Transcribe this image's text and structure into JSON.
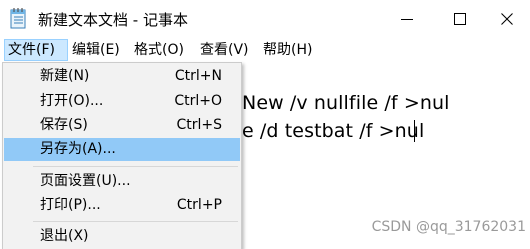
{
  "window": {
    "title": "新建文本文档 - 记事本"
  },
  "menubar": {
    "items": [
      {
        "label": "文件(F)"
      },
      {
        "label": "编辑(E)"
      },
      {
        "label": "格式(O)"
      },
      {
        "label": "查看(V)"
      },
      {
        "label": "帮助(H)"
      }
    ]
  },
  "file_menu": {
    "items": [
      {
        "label": "新建(N)",
        "shortcut": "Ctrl+N"
      },
      {
        "label": "打开(O)...",
        "shortcut": "Ctrl+O"
      },
      {
        "label": "保存(S)",
        "shortcut": "Ctrl+S"
      },
      {
        "label": "另存为(A)...",
        "shortcut": ""
      },
      {
        "label": "页面设置(U)...",
        "shortcut": ""
      },
      {
        "label": "打印(P)...",
        "shortcut": "Ctrl+P"
      },
      {
        "label": "退出(X)",
        "shortcut": ""
      }
    ],
    "highlighted_item": "另存为(A)..."
  },
  "editor": {
    "line1_visible": "New /v nullfile /f >nul",
    "line2_visible": "e /d testbat /f >nul"
  },
  "watermark": {
    "text": "CSDN @qq_31762031"
  },
  "colors": {
    "menu_active_bg": "#cce8ff",
    "menu_highlight_bg": "#91c9f7",
    "dropdown_bg": "#f2f2f2",
    "watermark": "#9a9a9a"
  },
  "icons": {
    "app": "notepad-icon",
    "minimize": "minimize-icon",
    "maximize": "maximize-icon",
    "close": "close-icon"
  }
}
